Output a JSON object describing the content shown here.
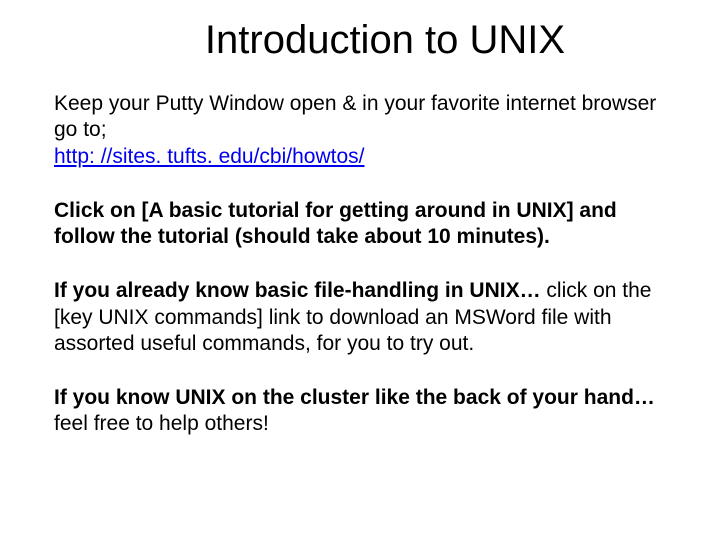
{
  "title": "Introduction to UNIX",
  "p1_text": "Keep your Putty Window open & in your favorite internet browser go to;",
  "p1_link": "http: //sites. tufts. edu/cbi/howtos/",
  "p2": "Click on [A basic tutorial for getting around in UNIX] and follow the tutorial (should take about 10 minutes).",
  "p3_bold": "If you already know basic file-handling in UNIX… ",
  "p3_rest": "click on the [key UNIX commands] link to download an MSWord file with assorted useful commands, for you to try out.",
  "p4_bold": "If you know UNIX on the cluster like the back of your hand… ",
  "p4_rest": "feel free to help others!"
}
